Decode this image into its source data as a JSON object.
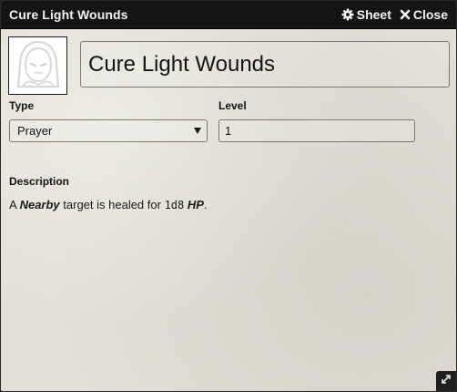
{
  "window": {
    "title": "Cure Light Wounds",
    "sheet_label": "Sheet",
    "close_label": "Close"
  },
  "item": {
    "name": "Cure Light Wounds",
    "type_label": "Type",
    "type_value": "Prayer",
    "level_label": "Level",
    "level_value": "1"
  },
  "description": {
    "label": "Description",
    "part1": "A ",
    "nearby": "Nearby",
    "part2": " target is healed for ",
    "dice": "1d8",
    "part3": " ",
    "hp": "HP",
    "part4": "."
  },
  "icons": {
    "portrait": "hooded-figure-icon",
    "sheet": "gear-icon",
    "close": "close-icon",
    "resize": "resize-icon",
    "select": "chevron-down-icon"
  },
  "colors": {
    "titlebar": "#151515",
    "panel": "#e2e0d6",
    "text": "#141414"
  }
}
